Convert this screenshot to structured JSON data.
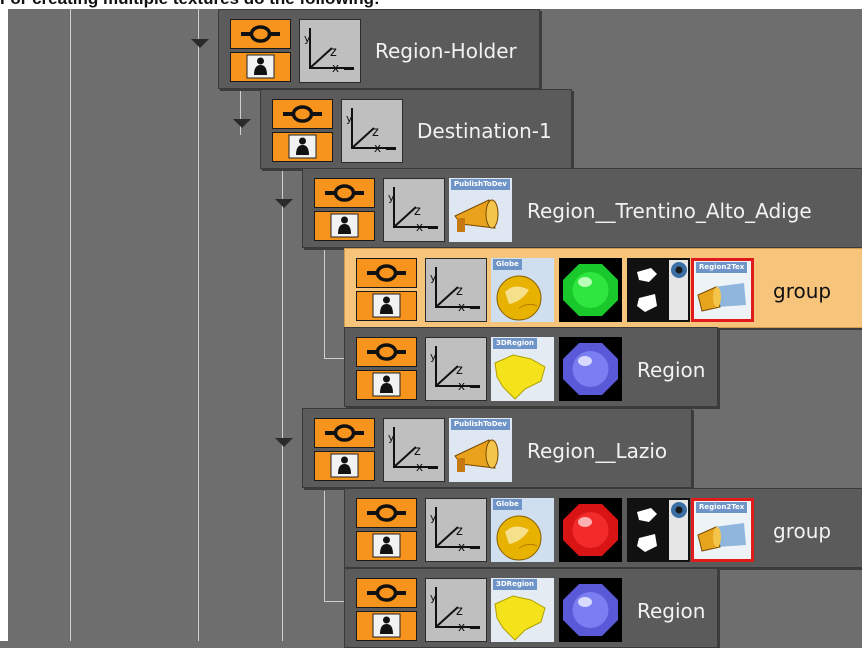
{
  "caption": {
    "prefix": "For creating ",
    "bold": "multiple textures",
    "suffix": " do the following:"
  },
  "colors": {
    "background": "#6e6e6e",
    "row": "#5b5b5b",
    "selected_row": "#f6c47a",
    "control_orange": "#f7941d",
    "selection_border": "#e01b1b"
  },
  "tree": [
    {
      "label": "Region-Holder",
      "plugins": []
    },
    {
      "label": "Destination-1",
      "plugins": []
    },
    {
      "label": "Region__Trentino_Alto_Adige",
      "plugins": [
        {
          "icon": "publish-to-dev-icon",
          "tag": "PublishToDev"
        }
      ]
    },
    {
      "label": "group",
      "selected": true,
      "plugins": [
        {
          "icon": "globe-icon",
          "tag": "Globe"
        },
        {
          "icon": "green-material-ball-icon"
        },
        {
          "icon": "map-mask-icon"
        },
        {
          "icon": "region2tex-icon",
          "tag": "Region2Tex",
          "selected": true
        }
      ]
    },
    {
      "label": "Region",
      "plugins": [
        {
          "icon": "region-3d-map-icon",
          "tag": "3DRegion"
        },
        {
          "icon": "blue-material-ball-icon"
        }
      ]
    },
    {
      "label": "Region__Lazio",
      "plugins": [
        {
          "icon": "publish-to-dev-icon",
          "tag": "PublishToDev"
        }
      ]
    },
    {
      "label": "group",
      "plugins": [
        {
          "icon": "globe-icon",
          "tag": "Globe"
        },
        {
          "icon": "red-material-ball-icon"
        },
        {
          "icon": "map-mask-icon"
        },
        {
          "icon": "region2tex-icon",
          "tag": "Region2Tex",
          "selected": true
        }
      ]
    },
    {
      "label": "Region",
      "plugins": [
        {
          "icon": "region-3d-map-icon",
          "tag": "3DRegion"
        },
        {
          "icon": "blue-material-ball-icon"
        }
      ]
    }
  ]
}
